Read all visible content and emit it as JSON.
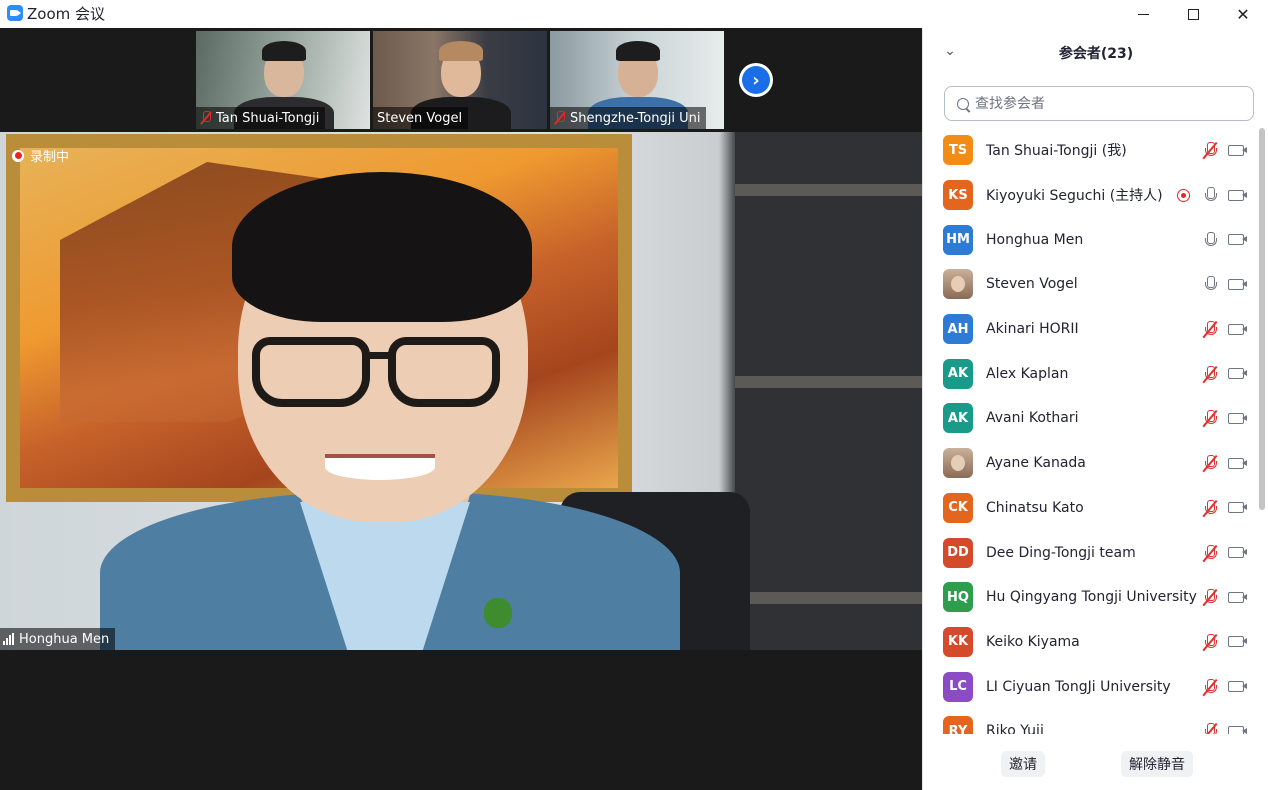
{
  "window": {
    "title": "Zoom 会议"
  },
  "gallery": {
    "thumbnails": [
      {
        "name": "Tan Shuai-Tongji",
        "muted": true
      },
      {
        "name": "Steven Vogel",
        "muted": false
      },
      {
        "name": "Shengzhe-Tongji Uni",
        "muted": true
      }
    ],
    "next_label": "›"
  },
  "main_video": {
    "recording_label": "录制中",
    "speaker_name": "Honghua Men"
  },
  "participants": {
    "title": "参会者(23)",
    "search_placeholder": "查找参会者",
    "list": [
      {
        "initials": "TS",
        "color": "#f28c14",
        "name": "Tan Shuai-Tongji (我)",
        "mic": "off",
        "recording": false
      },
      {
        "initials": "KS",
        "color": "#e4661e",
        "name": "Kiyoyuki Seguchi (主持人)",
        "mic": "on",
        "recording": true
      },
      {
        "initials": "HM",
        "color": "#2e7bd6",
        "name": "Honghua Men",
        "mic": "on",
        "recording": false
      },
      {
        "initials": "",
        "color": "photo",
        "name": "Steven Vogel",
        "mic": "on",
        "recording": false
      },
      {
        "initials": "AH",
        "color": "#2e7bd6",
        "name": "Akinari HORII",
        "mic": "off",
        "recording": false
      },
      {
        "initials": "AK",
        "color": "#1a9b8a",
        "name": "Alex Kaplan",
        "mic": "off",
        "recording": false
      },
      {
        "initials": "AK",
        "color": "#1a9b8a",
        "name": "Avani Kothari",
        "mic": "off",
        "recording": false
      },
      {
        "initials": "",
        "color": "photo",
        "name": "Ayane Kanada",
        "mic": "off",
        "recording": false
      },
      {
        "initials": "CK",
        "color": "#e4661e",
        "name": "Chinatsu Kato",
        "mic": "off",
        "recording": false
      },
      {
        "initials": "DD",
        "color": "#d44a2a",
        "name": "Dee Ding-Tongji team",
        "mic": "off",
        "recording": false
      },
      {
        "initials": "HQ",
        "color": "#2e9e4e",
        "name": "Hu Qingyang Tongji University",
        "mic": "off",
        "recording": false
      },
      {
        "initials": "KK",
        "color": "#d44a2a",
        "name": "Keiko Kiyama",
        "mic": "off",
        "recording": false
      },
      {
        "initials": "LC",
        "color": "#8a4bc4",
        "name": "LI Ciyuan TongJi University",
        "mic": "off",
        "recording": false
      },
      {
        "initials": "RY",
        "color": "#e4661e",
        "name": "Riko Yuii",
        "mic": "off",
        "recording": false
      }
    ],
    "invite_label": "邀请",
    "unmute_all_label": "解除静音"
  }
}
